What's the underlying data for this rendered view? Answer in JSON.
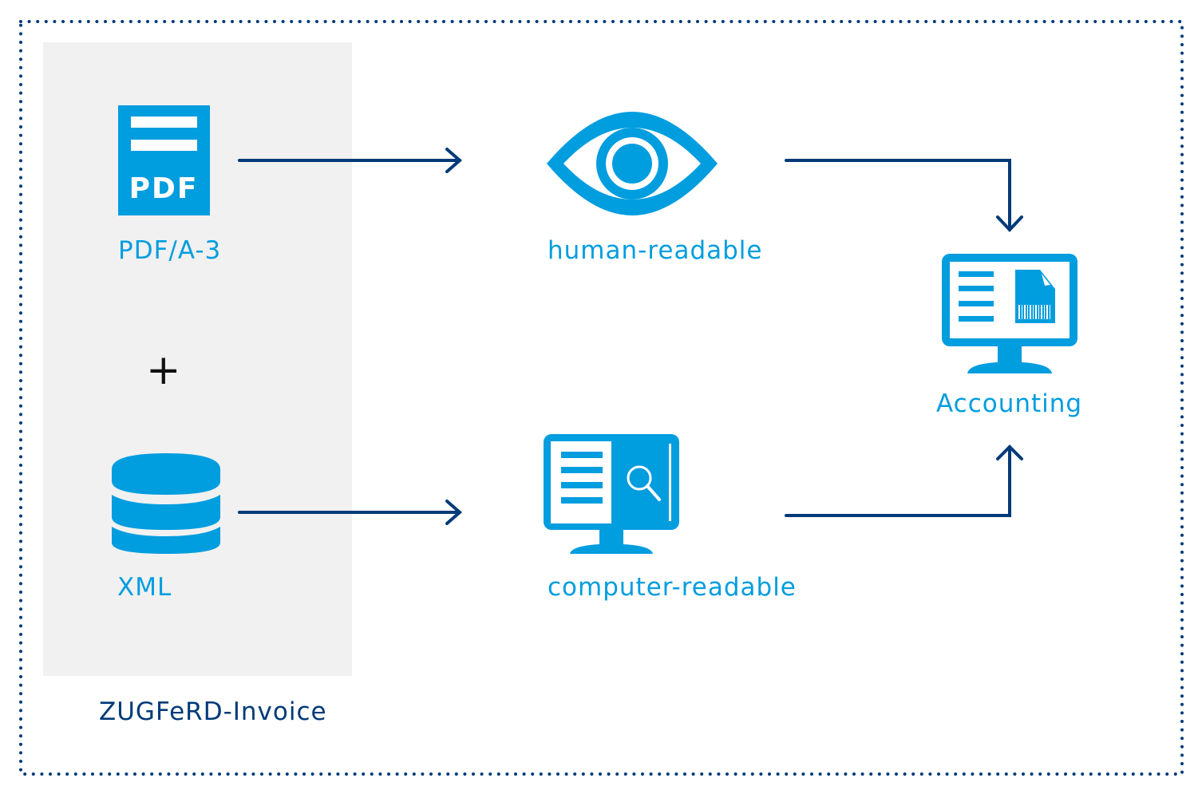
{
  "diagram": {
    "title": "ZUGFeRD-Invoice",
    "colors": {
      "accent": "#009ddf",
      "arrow": "#003a78",
      "panel": "#f1f1f1",
      "border": "#003a78"
    },
    "source": {
      "pdf": {
        "icon": "pdf-document-icon",
        "icon_text": "PDF",
        "label": "PDF/A-3"
      },
      "plus": "+",
      "xml": {
        "icon": "database-icon",
        "label": "XML"
      }
    },
    "middle": {
      "human": {
        "icon": "eye-icon",
        "label": "human-readable"
      },
      "computer": {
        "icon": "monitor-search-icon",
        "label": "computer-readable"
      }
    },
    "target": {
      "icon": "monitor-invoice-icon",
      "label": "Accounting"
    },
    "edges": [
      {
        "from": "PDF/A-3",
        "to": "human-readable"
      },
      {
        "from": "XML",
        "to": "computer-readable"
      },
      {
        "from": "human-readable",
        "to": "Accounting"
      },
      {
        "from": "computer-readable",
        "to": "Accounting"
      }
    ]
  }
}
